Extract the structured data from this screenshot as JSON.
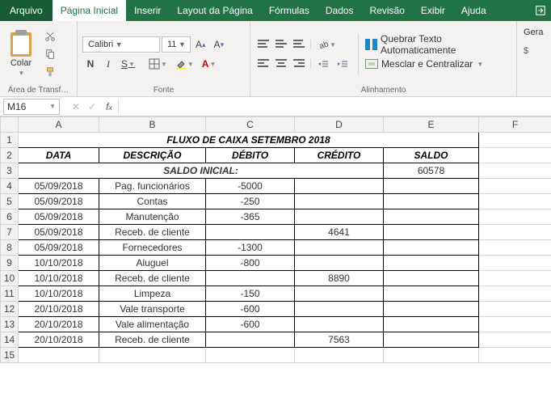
{
  "tabs": {
    "file": "Arquivo",
    "home": "Página Inicial",
    "insert": "Inserir",
    "layout": "Layout da Página",
    "formulas": "Fórmulas",
    "data": "Dados",
    "review": "Revisão",
    "view": "Exibir",
    "help": "Ajuda"
  },
  "ribbon": {
    "paste_label": "Colar",
    "clipboard_group": "Área de Transf…",
    "font_group": "Fonte",
    "alignment_group": "Alinhamento",
    "font_name": "Calibri",
    "font_size": "11",
    "wrap_text": "Quebrar Texto Automaticamente",
    "merge_center": "Mesclar e Centralizar",
    "number_format": "Gera"
  },
  "namebox": "M16",
  "cols": {
    "A": "A",
    "B": "B",
    "C": "C",
    "D": "D",
    "E": "E",
    "F": "F"
  },
  "sheet": {
    "title": "FLUXO DE CAIXA SETEMBRO 2018",
    "headers": {
      "data": "DATA",
      "descricao": "DESCRIÇÃO",
      "debito": "DÉBITO",
      "credito": "CRÉDITO",
      "saldo": "SALDO"
    },
    "saldo_inicial_label": "SALDO INICIAL:",
    "saldo_inicial_value": "60578",
    "rows": [
      {
        "n": "4",
        "data": "05/09/2018",
        "desc": "Pag. funcionários",
        "deb": "-5000",
        "cred": ""
      },
      {
        "n": "5",
        "data": "05/09/2018",
        "desc": "Contas",
        "deb": "-250",
        "cred": ""
      },
      {
        "n": "6",
        "data": "05/09/2018",
        "desc": "Manutenção",
        "deb": "-365",
        "cred": ""
      },
      {
        "n": "7",
        "data": "05/09/2018",
        "desc": "Receb. de cliente",
        "deb": "",
        "cred": "4641"
      },
      {
        "n": "8",
        "data": "05/09/2018",
        "desc": "Fornecedores",
        "deb": "-1300",
        "cred": ""
      },
      {
        "n": "9",
        "data": "10/10/2018",
        "desc": "Aluguel",
        "deb": "-800",
        "cred": ""
      },
      {
        "n": "10",
        "data": "10/10/2018",
        "desc": "Receb. de cliente",
        "deb": "",
        "cred": "8890"
      },
      {
        "n": "11",
        "data": "10/10/2018",
        "desc": "Limpeza",
        "deb": "-150",
        "cred": ""
      },
      {
        "n": "12",
        "data": "20/10/2018",
        "desc": "Vale transporte",
        "deb": "-600",
        "cred": ""
      },
      {
        "n": "13",
        "data": "20/10/2018",
        "desc": "Vale alimentação",
        "deb": "-600",
        "cred": ""
      },
      {
        "n": "14",
        "data": "20/10/2018",
        "desc": "Receb. de cliente",
        "deb": "",
        "cred": "7563"
      }
    ],
    "empty_row": "15"
  }
}
